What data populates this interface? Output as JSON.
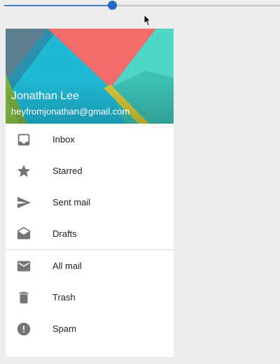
{
  "slider": {
    "value": 0.39
  },
  "account": {
    "name": "Jonathan Lee",
    "email": "heyfromjonathan@gmail.com"
  },
  "menu": {
    "primary": [
      {
        "label": "Inbox",
        "icon": "inbox-icon"
      },
      {
        "label": "Starred",
        "icon": "star-icon"
      },
      {
        "label": "Sent mail",
        "icon": "send-icon"
      },
      {
        "label": "Drafts",
        "icon": "drafts-icon"
      }
    ],
    "secondary": [
      {
        "label": "All mail",
        "icon": "mail-icon"
      },
      {
        "label": "Trash",
        "icon": "trash-icon"
      },
      {
        "label": "Spam",
        "icon": "spam-icon"
      }
    ]
  },
  "colors": {
    "accent": "#1e6ac6",
    "icon": "#757575",
    "header_red": "#f36c6c",
    "header_cyan": "#1fb9d6",
    "header_teal": "#4ed6c8",
    "header_green": "#8bc34a",
    "header_yellow": "#d4c93b"
  }
}
